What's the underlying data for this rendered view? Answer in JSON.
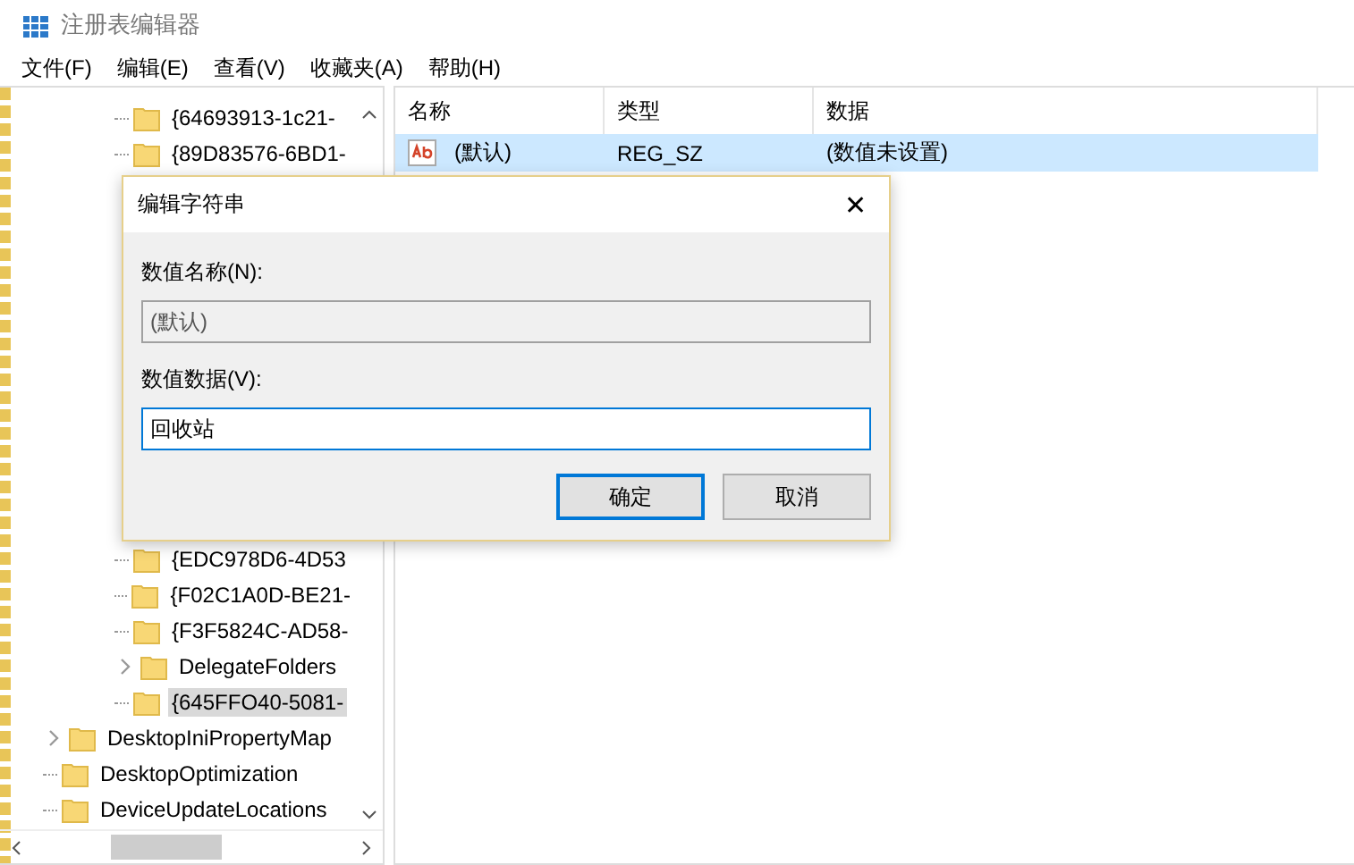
{
  "window": {
    "title": "注册表编辑器"
  },
  "menu": [
    "文件(F)",
    "编辑(E)",
    "查看(V)",
    "收藏夹(A)",
    "帮助(H)"
  ],
  "tree": {
    "upper_items": [
      {
        "label": "{64693913-1c21-",
        "expandable": false,
        "selected": false
      },
      {
        "label": "{89D83576-6BD1-",
        "expandable": false,
        "selected": false
      }
    ],
    "lower_items": [
      {
        "label": "{EDC978D6-4D53",
        "expandable": false,
        "selected": false
      },
      {
        "label": "{F02C1A0D-BE21-",
        "expandable": false,
        "selected": false
      },
      {
        "label": "{F3F5824C-AD58-",
        "expandable": false,
        "selected": false
      },
      {
        "label": "DelegateFolders",
        "expandable": true,
        "selected": false
      },
      {
        "label": "{645FFO40-5081-",
        "expandable": false,
        "selected": true
      }
    ],
    "items": [
      {
        "label": "DesktopIniPropertyMap",
        "expandable": true,
        "selected": false
      },
      {
        "label": "DesktopOptimization",
        "expandable": false,
        "selected": false
      },
      {
        "label": "DeviceUpdateLocations",
        "expandable": false,
        "selected": false
      }
    ]
  },
  "list": {
    "columns": [
      "名称",
      "类型",
      "数据"
    ],
    "rows": [
      {
        "name": "(默认)",
        "type": "REG_SZ",
        "data": "(数值未设置)",
        "selected": true
      }
    ]
  },
  "dialog": {
    "title": "编辑字符串",
    "close": "✕",
    "name_label": "数值名称(N):",
    "name_value": "(默认)",
    "data_label": "数值数据(V):",
    "data_value": "回收站",
    "buttons": [
      {
        "label": "确定",
        "default": true
      },
      {
        "label": "取消",
        "default": false
      }
    ]
  }
}
